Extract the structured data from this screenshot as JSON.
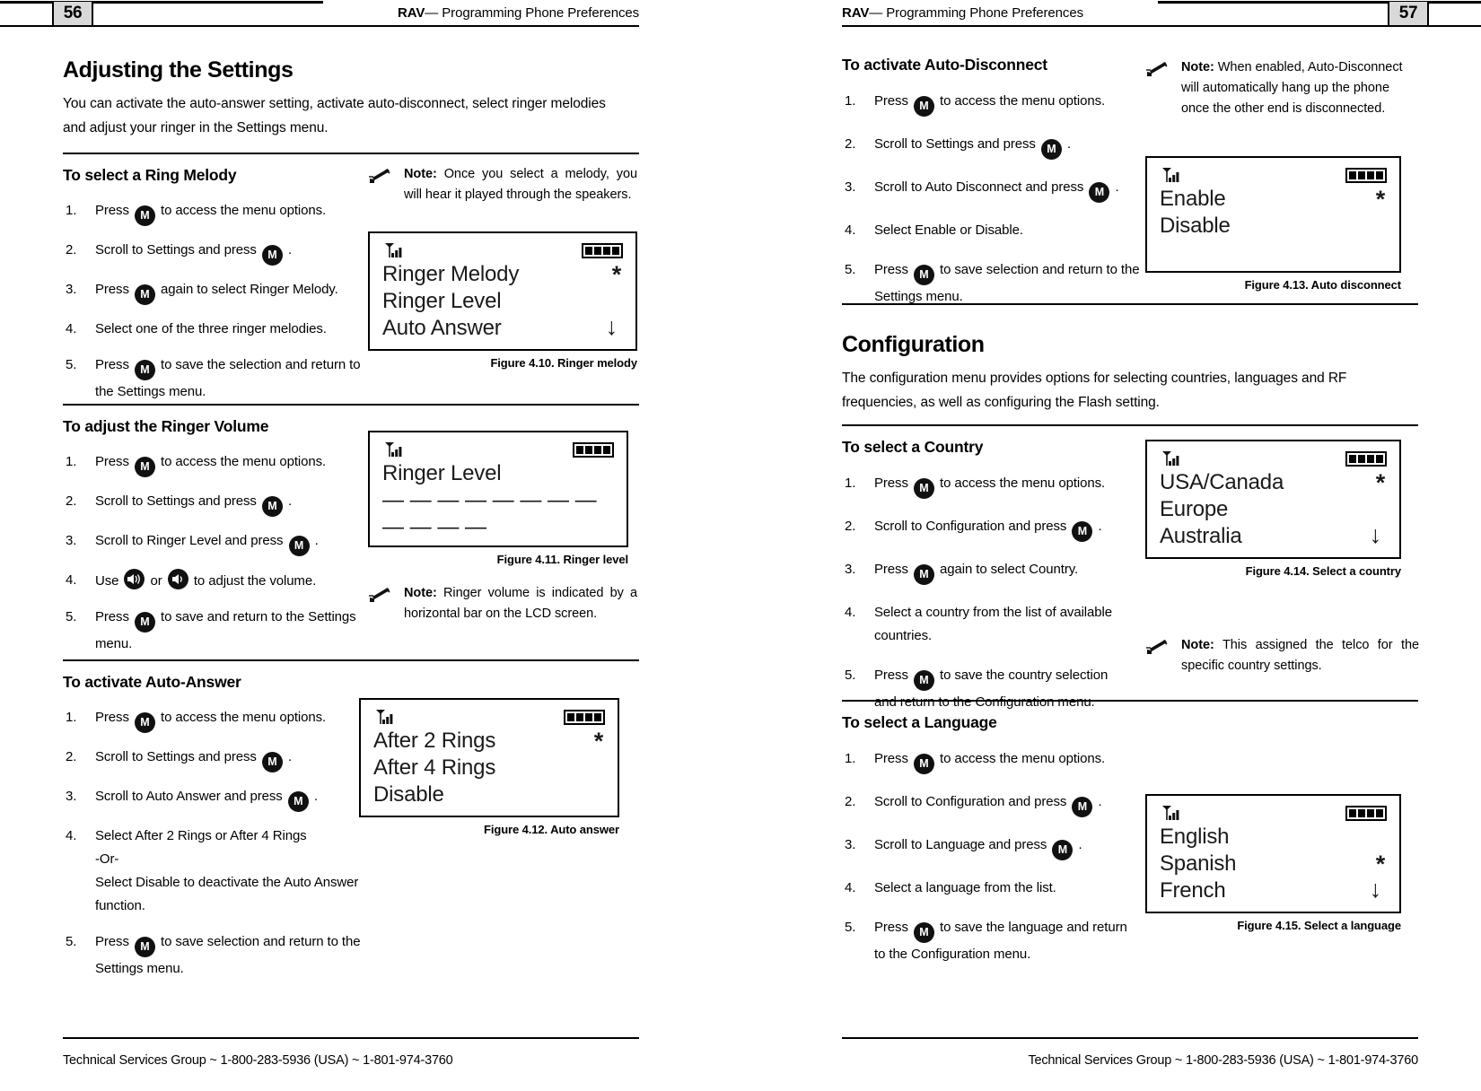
{
  "left_page": {
    "page_number": "56",
    "header_prefix": "RAV",
    "header_dash": "—",
    "header_title": "Programming Phone Preferences",
    "footer": "Technical Services Group ~ 1-800-283-5936 (USA) ~ 1-801-974-3760",
    "h1": "Adjusting the Settings",
    "intro": "You can activate the auto-answer setting, activate auto-disconnect, select ringer melodies and adjust your ringer in the Settings menu.",
    "sections": [
      {
        "heading": "To select a Ring Melody",
        "steps": [
          {
            "num": "1.",
            "pre": "Press",
            "icon": "M",
            "post": "to access the menu options."
          },
          {
            "num": "2.",
            "pre": "Scroll to Settings and press",
            "icon": "M",
            "post": "."
          },
          {
            "num": "3.",
            "pre": "Press",
            "icon": "M",
            "post": "again to select Ringer Melody."
          },
          {
            "num": "4.",
            "pre": "Select one of the three ringer melodies.",
            "icon": "",
            "post": ""
          },
          {
            "num": "5.",
            "pre": "Press",
            "icon": "M",
            "post": "to save the selection and return to the Settings menu."
          }
        ],
        "note": {
          "label": "Note:",
          "text": "Once you select a melody, you will hear it played through the speakers."
        },
        "figure": {
          "caption": "Figure 4.10. Ringer melody",
          "lines": [
            {
              "text": "Ringer Melody",
              "mark": "*"
            },
            {
              "text": "Ringer Level",
              "mark": ""
            },
            {
              "text": "Auto Answer",
              "arrow": "↓"
            }
          ]
        }
      },
      {
        "heading": "To adjust the Ringer Volume",
        "steps": [
          {
            "num": "1.",
            "pre": "Press",
            "icon": "M",
            "post": "to access the menu options."
          },
          {
            "num": "2.",
            "pre": "Scroll to Settings and press",
            "icon": "M",
            "post": "."
          },
          {
            "num": "3.",
            "pre": "Scroll to Ringer Level and press",
            "icon": "M",
            "post": "."
          },
          {
            "num": "4.",
            "pre": "Use",
            "icon": "SPK2",
            "post": "to adjust the volume.",
            "mid": "or"
          },
          {
            "num": "5.",
            "pre": "Press",
            "icon": "M",
            "post": "to save and return to the Settings menu."
          }
        ],
        "note": {
          "label": "Note:",
          "text": "Ringer volume is indicated by a horizontal bar on the LCD screen."
        },
        "figure": {
          "caption": "Figure 4.11. Ringer level",
          "lines": [
            {
              "text": "Ringer Level",
              "mark": ""
            }
          ],
          "bar": "— — — — — — — — — — — —"
        }
      },
      {
        "heading": "To activate Auto-Answer",
        "steps": [
          {
            "num": "1.",
            "pre": "Press",
            "icon": "M",
            "post": "to access the menu options."
          },
          {
            "num": "2.",
            "pre": "Scroll to Settings and press",
            "icon": "M",
            "post": "."
          },
          {
            "num": "3.",
            "pre": "Scroll to Auto Answer and press",
            "icon": "M",
            "post": "."
          },
          {
            "num": "4.",
            "pre": "Select After 2 Rings or After 4 Rings",
            "icon": "",
            "post": "",
            "sub1": "-Or-",
            "sub2": "Select Disable to deactivate the Auto Answer function."
          },
          {
            "num": "5.",
            "pre": "Press",
            "icon": "M",
            "post": "to save selection and return to the Settings menu."
          }
        ],
        "figure": {
          "caption": "Figure 4.12. Auto answer",
          "lines": [
            {
              "text": "After 2 Rings",
              "mark": "*"
            },
            {
              "text": "After 4 Rings",
              "mark": ""
            },
            {
              "text": "Disable",
              "mark": ""
            }
          ]
        }
      }
    ]
  },
  "right_page": {
    "page_number": "57",
    "header_prefix": "RAV",
    "header_dash": "—",
    "header_title": "Programming Phone Preferences",
    "footer": "Technical Services Group ~ 1-800-283-5936 (USA) ~ 1-801-974-3760",
    "sections": [
      {
        "heading": "To activate Auto-Disconnect",
        "steps": [
          {
            "num": "1.",
            "pre": "Press",
            "icon": "M",
            "post": "to access the menu options."
          },
          {
            "num": "2.",
            "pre": "Scroll to Settings and press",
            "icon": "M",
            "post": "."
          },
          {
            "num": "3.",
            "pre": "Scroll to Auto Disconnect and press",
            "icon": "M",
            "post": "."
          },
          {
            "num": "4.",
            "pre": "Select Enable or Disable.",
            "icon": "",
            "post": ""
          },
          {
            "num": "5.",
            "pre": "Press",
            "icon": "M",
            "post": "to save selection and return to the Settings menu."
          }
        ],
        "note": {
          "label": "Note:",
          "text": "When enabled, Auto-Disconnect will automatically hang up the phone once the other end is disconnected."
        },
        "figure": {
          "caption": "Figure 4.13. Auto disconnect",
          "lines": [
            {
              "text": "Enable",
              "mark": "*"
            },
            {
              "text": "Disable",
              "mark": ""
            }
          ]
        }
      }
    ],
    "config": {
      "h1": "Configuration",
      "intro": "The configuration menu provides options for selecting countries, languages and RF frequencies, as well as configuring the Flash setting.",
      "sections": [
        {
          "heading": "To select a Country",
          "steps": [
            {
              "num": "1.",
              "pre": "Press",
              "icon": "M",
              "post": "to access the menu options."
            },
            {
              "num": "2.",
              "pre": "Scroll to Configuration and press",
              "icon": "M",
              "post": "."
            },
            {
              "num": "3.",
              "pre": "Press",
              "icon": "M",
              "post": "again to select Country."
            },
            {
              "num": "4.",
              "pre": "Select a country from the list of available countries.",
              "icon": "",
              "post": ""
            },
            {
              "num": "5.",
              "pre": "Press",
              "icon": "M",
              "post": "to save the country selection and return to the Configuration menu."
            }
          ],
          "note": {
            "label": "Note:",
            "text": "This assigned the telco for the specific country settings."
          },
          "figure": {
            "caption": "Figure 4.14. Select a country",
            "lines": [
              {
                "text": "USA/Canada",
                "mark": "*"
              },
              {
                "text": "Europe",
                "mark": ""
              },
              {
                "text": "Australia",
                "arrow": "↓"
              }
            ]
          }
        },
        {
          "heading": "To select a Language",
          "steps": [
            {
              "num": "1.",
              "pre": "Press",
              "icon": "M",
              "post": "to access the menu options."
            },
            {
              "num": "2.",
              "pre": "Scroll to Configuration and press",
              "icon": "M",
              "post": "."
            },
            {
              "num": "3.",
              "pre": "Scroll to Language and press",
              "icon": "M",
              "post": "."
            },
            {
              "num": "4.",
              "pre": "Select a language from the list.",
              "icon": "",
              "post": ""
            },
            {
              "num": "5.",
              "pre": "Press",
              "icon": "M",
              "post": "to save the language and return to the Configuration menu."
            }
          ],
          "figure": {
            "caption": "Figure 4.15. Select a language",
            "lines": [
              {
                "text": "English",
                "mark": ""
              },
              {
                "text": "Spanish",
                "mark": "*"
              },
              {
                "text": "French",
                "arrow": "↓"
              }
            ]
          }
        }
      ]
    }
  }
}
